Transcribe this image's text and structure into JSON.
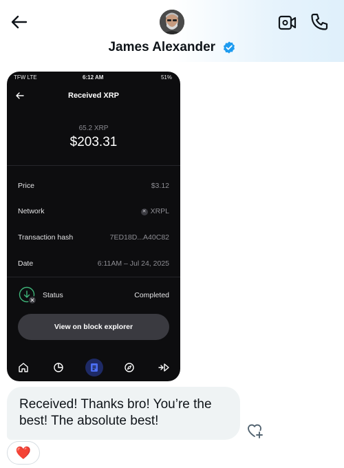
{
  "header": {
    "contact_name": "James Alexander",
    "back_icon": "arrow-left-icon",
    "video_icon": "video-call-icon",
    "phone_icon": "phone-icon",
    "verified_icon": "verified-badge-icon",
    "verified_color": "#1d9bf0"
  },
  "screenshot": {
    "status_bar": {
      "carrier": "TFW  LTE",
      "time": "6:12 AM",
      "battery": "51%"
    },
    "title": "Received XRP",
    "amount_crypto": "65.2 XRP",
    "amount_fiat": "$203.31",
    "rows": [
      {
        "label": "Price",
        "value": "$3.12"
      },
      {
        "label": "Network",
        "value": "XRPL"
      },
      {
        "label": "Transaction hash",
        "value": "7ED18D...A40C82"
      },
      {
        "label": "Date",
        "value": "6:11AM – Jul 24, 2025"
      }
    ],
    "status_label": "Status",
    "status_value": "Completed",
    "explorer_button": "View on block explorer",
    "nav_icons": [
      "home-icon",
      "portfolio-icon",
      "activity-icon",
      "explore-icon",
      "send-receive-icon"
    ],
    "accent": "#3b5bdb"
  },
  "message": {
    "text": "Received! Thanks bro! You’re the best! The absolute best!",
    "reaction": "❤️",
    "add_reaction_icon": "heart-plus-icon"
  }
}
